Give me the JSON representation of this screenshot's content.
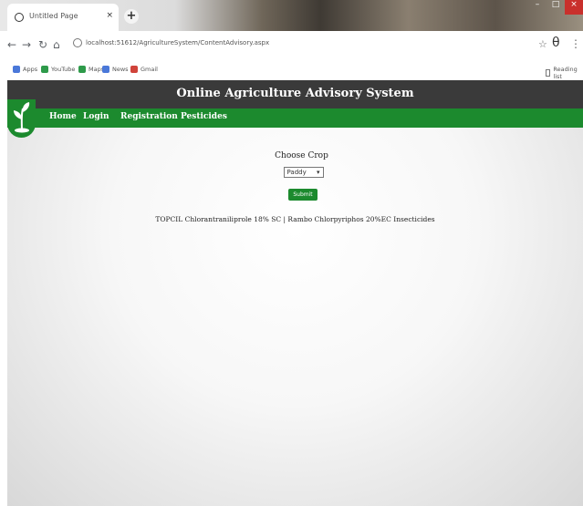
{
  "browser": {
    "tab_title": "Untitled Page",
    "tab_close": "×",
    "new_tab": "+",
    "window_controls": [
      "–",
      "□",
      "×"
    ],
    "nav": {
      "back": "←",
      "forward": "→",
      "reload": "↻",
      "home": "⌂"
    },
    "address": "localhost:51612/AgricultureSystem/ContentAdvisory.aspx",
    "star": "☆",
    "profile": "θ",
    "menu": "⋮",
    "bookmarks": [
      {
        "label": "Apps",
        "color": "#4a78d9"
      },
      {
        "label": "YouTube",
        "color": "#2e9a4a"
      },
      {
        "label": "Maps",
        "color": "#2e9a4a"
      },
      {
        "label": "News",
        "color": "#4a78d9"
      },
      {
        "label": "Gmail",
        "color": "#d0433a"
      }
    ],
    "reading_list": "Reading list"
  },
  "site": {
    "title": "Online Agriculture Advisory System",
    "nav": [
      "Home",
      "Login",
      "Registration",
      "Pesticides"
    ],
    "form": {
      "label": "Choose Crop",
      "selected_crop": "Paddy",
      "submit_label": "Submit"
    },
    "result": "TOPCIL Chlorantraniliprole 18% SC | Rambo Chlorpyriphos 20%EC Insecticides"
  }
}
